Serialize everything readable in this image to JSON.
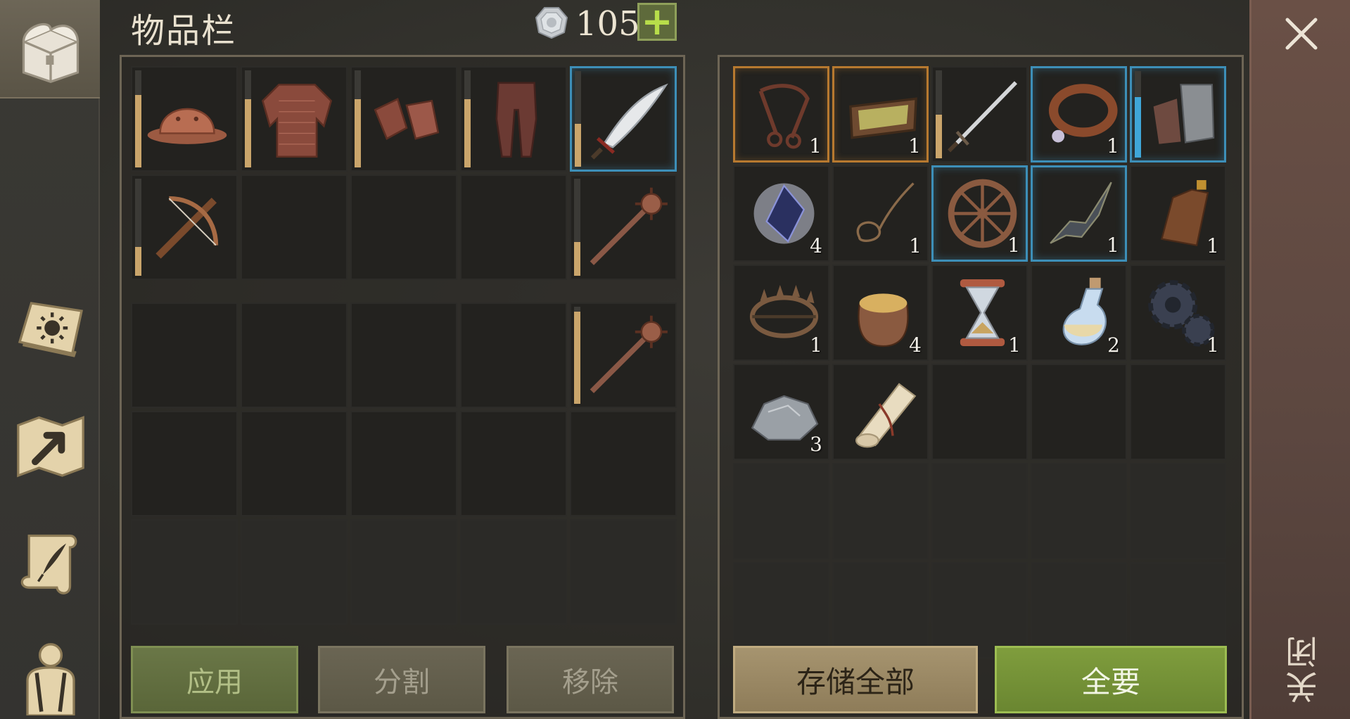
{
  "header": {
    "title": "物品栏",
    "currency": {
      "icon": "silver-coin-icon",
      "value": "105"
    },
    "add_label": "+"
  },
  "sidebar": {
    "items": [
      {
        "icon": "chest-icon",
        "active": true
      },
      {
        "icon": "sun-book-icon",
        "active": false
      },
      {
        "icon": "map-arrow-icon",
        "active": false
      },
      {
        "icon": "scroll-quill-icon",
        "active": false
      },
      {
        "icon": "character-icon",
        "active": false
      }
    ]
  },
  "close": {
    "label": "关闭",
    "icon": "close-x-icon"
  },
  "equipment": {
    "slots": [
      {
        "icon": "helmet-icon",
        "durability": 0.75
      },
      {
        "icon": "chainmail-icon",
        "durability": 0.7
      },
      {
        "icon": "gauntlets-icon",
        "durability": 0.7
      },
      {
        "icon": "leggings-icon",
        "durability": 0.7
      },
      {
        "icon": "scimitar-icon",
        "durability": 0.45,
        "rarity": "blue"
      },
      {
        "icon": "crossbow-icon",
        "durability": 0.3
      },
      {
        "icon": "",
        "durability": null
      },
      {
        "icon": "",
        "durability": null
      },
      {
        "icon": "",
        "durability": null
      },
      {
        "icon": "mace-icon",
        "durability": 0.35
      }
    ]
  },
  "backpack": {
    "slots": [
      {
        "icon": "",
        "durability": null
      },
      {
        "icon": "",
        "durability": null
      },
      {
        "icon": "",
        "durability": null
      },
      {
        "icon": "",
        "durability": null
      },
      {
        "icon": "mace-icon",
        "durability": 0.95
      },
      {
        "icon": "",
        "durability": null
      },
      {
        "icon": "",
        "durability": null
      },
      {
        "icon": "",
        "durability": null
      },
      {
        "icon": "",
        "durability": null
      },
      {
        "icon": "",
        "durability": null
      },
      {
        "icon": "",
        "durability": null
      },
      {
        "icon": "",
        "durability": null
      },
      {
        "icon": "",
        "durability": null
      },
      {
        "icon": "",
        "durability": null
      },
      {
        "icon": "",
        "durability": null
      }
    ]
  },
  "storage": {
    "slots": [
      {
        "icon": "bridle-icon",
        "qty": "1",
        "rarity": "orange"
      },
      {
        "icon": "feeding-trough-icon",
        "qty": "1",
        "rarity": "orange"
      },
      {
        "icon": "longsword-icon",
        "qty": "",
        "durability": 0.5
      },
      {
        "icon": "dog-collar-icon",
        "qty": "1",
        "rarity": "blue"
      },
      {
        "icon": "plate-gauntlet-icon",
        "qty": "",
        "rarity": "blue",
        "durability": 0.7,
        "durability_color": "blue"
      },
      {
        "icon": "crystal-icon",
        "qty": "4"
      },
      {
        "icon": "rope-icon",
        "qty": "1"
      },
      {
        "icon": "wagon-wheel-icon",
        "qty": "1",
        "rarity": "blue"
      },
      {
        "icon": "blade-fragment-icon",
        "qty": "1",
        "rarity": "blue"
      },
      {
        "icon": "bottle-icon",
        "qty": "1"
      },
      {
        "icon": "bear-trap-icon",
        "qty": "1"
      },
      {
        "icon": "grain-sack-icon",
        "qty": "4"
      },
      {
        "icon": "hourglass-icon",
        "qty": "1"
      },
      {
        "icon": "potion-icon",
        "qty": "2"
      },
      {
        "icon": "gears-icon",
        "qty": "1"
      },
      {
        "icon": "stone-icon",
        "qty": "3"
      },
      {
        "icon": "paper-roll-icon",
        "qty": ""
      },
      {
        "icon": "",
        "qty": ""
      },
      {
        "icon": "",
        "qty": ""
      },
      {
        "icon": "",
        "qty": ""
      },
      {
        "icon": "",
        "qty": ""
      },
      {
        "icon": "",
        "qty": ""
      },
      {
        "icon": "",
        "qty": ""
      },
      {
        "icon": "",
        "qty": ""
      },
      {
        "icon": "",
        "qty": ""
      },
      {
        "icon": "",
        "qty": ""
      },
      {
        "icon": "",
        "qty": ""
      },
      {
        "icon": "",
        "qty": ""
      },
      {
        "icon": "",
        "qty": ""
      },
      {
        "icon": "",
        "qty": ""
      }
    ]
  },
  "buttons": {
    "apply": "应用",
    "split": "分割",
    "remove": "移除",
    "store_all": "存储全部",
    "take_all": "全要"
  },
  "colors": {
    "rarity_orange": "#b7792f",
    "rarity_blue": "#3d8fb8",
    "durability": "#caa56b",
    "accent_green": "#9dbd52"
  }
}
